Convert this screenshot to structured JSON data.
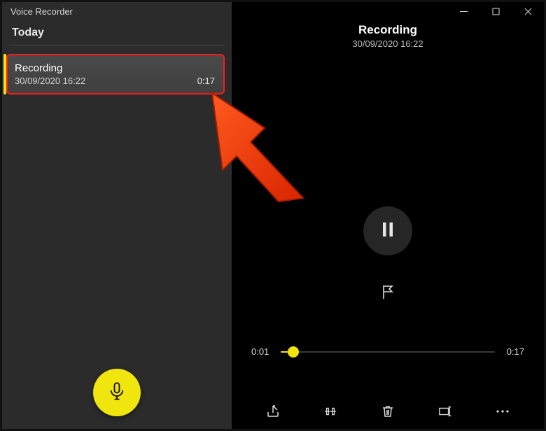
{
  "app": {
    "title": "Voice Recorder"
  },
  "sidebar": {
    "section_label": "Today",
    "items": [
      {
        "title": "Recording",
        "timestamp": "30/09/2020 16:22",
        "duration": "0:17"
      }
    ]
  },
  "player": {
    "title": "Recording",
    "timestamp": "30/09/2020 16:22",
    "elapsed": "0:01",
    "total": "0:17",
    "progress_pct": 6
  },
  "icons": {
    "mic": "mic-icon",
    "pause": "pause-icon",
    "flag": "flag-icon",
    "share": "share-icon",
    "trim": "trim-icon",
    "delete": "delete-icon",
    "rename": "rename-icon",
    "more": "more-icon",
    "minimize": "minimize-icon",
    "maximize": "maximize-icon",
    "close": "close-icon"
  },
  "colors": {
    "accent": "#f1e50e",
    "highlight": "#ff1a1a"
  }
}
